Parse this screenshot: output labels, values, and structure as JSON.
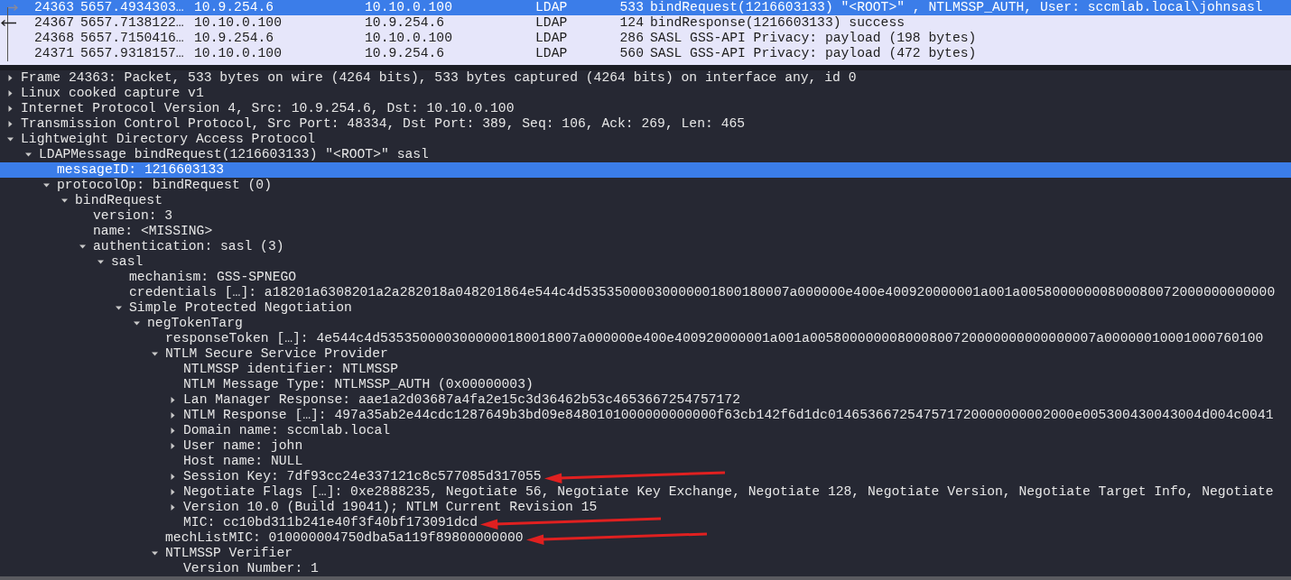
{
  "packet_list": {
    "rows": [
      {
        "no": "24363",
        "time": "5657.4934303…",
        "source": "10.9.254.6",
        "destination": "10.10.0.100",
        "protocol": "LDAP",
        "length": "533",
        "info": "bindRequest(1216603133) \"<ROOT>\" , NTLMSSP_AUTH, User: sccmlab.local\\johnsasl",
        "selected": true,
        "kind": "request"
      },
      {
        "no": "24367",
        "time": "5657.7138122…",
        "source": "10.10.0.100",
        "destination": "10.9.254.6",
        "protocol": "LDAP",
        "length": "124",
        "info": "bindResponse(1216603133) success",
        "selected": false,
        "kind": "response"
      },
      {
        "no": "24368",
        "time": "5657.7150416…",
        "source": "10.9.254.6",
        "destination": "10.10.0.100",
        "protocol": "LDAP",
        "length": "286",
        "info": "SASL GSS-API Privacy: payload (198 bytes)",
        "selected": false,
        "kind": "related"
      },
      {
        "no": "24371",
        "time": "5657.9318157…",
        "source": "10.10.0.100",
        "destination": "10.9.254.6",
        "protocol": "LDAP",
        "length": "560",
        "info": "SASL GSS-API Privacy: payload (472 bytes)",
        "selected": false,
        "kind": "related"
      }
    ]
  },
  "details": {
    "tree": [
      {
        "label": "Frame 24363: Packet, 533 bytes on wire (4264 bits), 533 bytes captured (4264 bits) on interface any, id 0",
        "expanded": false,
        "selected": false
      },
      {
        "label": "Linux cooked capture v1",
        "expanded": false,
        "selected": false
      },
      {
        "label": "Internet Protocol Version 4, Src: 10.9.254.6, Dst: 10.10.0.100",
        "expanded": false,
        "selected": false
      },
      {
        "label": "Transmission Control Protocol, Src Port: 48334, Dst Port: 389, Seq: 106, Ack: 269, Len: 465",
        "expanded": false,
        "selected": false
      },
      {
        "label": "Lightweight Directory Access Protocol",
        "expanded": true,
        "selected": false,
        "children": [
          {
            "label": "LDAPMessage bindRequest(1216603133) \"<ROOT>\" sasl",
            "expanded": true,
            "selected": false,
            "children": [
              {
                "label": "messageID: 1216603133",
                "selected": true
              },
              {
                "label": "protocolOp: bindRequest (0)",
                "expanded": true,
                "selected": false,
                "children": [
                  {
                    "label": "bindRequest",
                    "expanded": true,
                    "selected": false,
                    "children": [
                      {
                        "label": "version: 3",
                        "selected": false
                      },
                      {
                        "label": "name: <MISSING>",
                        "selected": false
                      },
                      {
                        "label": "authentication: sasl (3)",
                        "expanded": true,
                        "selected": false,
                        "children": [
                          {
                            "label": "sasl",
                            "expanded": true,
                            "selected": false,
                            "children": [
                              {
                                "label": "mechanism: GSS-SPNEGO",
                                "selected": false
                              },
                              {
                                "label": "credentials […]: a18201a6308201a2a282018a048201864e544c4d53535000030000001800180007a000000e400e400920000001a001a00580000000800080072000000000000",
                                "selected": false
                              },
                              {
                                "label": "Simple Protected Negotiation",
                                "expanded": true,
                                "selected": false,
                                "children": [
                                  {
                                    "label": "negTokenTarg",
                                    "expanded": true,
                                    "selected": false,
                                    "children": [
                                      {
                                        "label": "responseToken […]: 4e544c4d5353500003000000180018007a000000e400e400920000001a001a005800000008000800720000000000000007a00000010001000760100",
                                        "selected": false
                                      },
                                      {
                                        "label": "NTLM Secure Service Provider",
                                        "expanded": true,
                                        "selected": false,
                                        "children": [
                                          {
                                            "label": "NTLMSSP identifier: NTLMSSP",
                                            "selected": false
                                          },
                                          {
                                            "label": "NTLM Message Type: NTLMSSP_AUTH (0x00000003)",
                                            "selected": false
                                          },
                                          {
                                            "label": "Lan Manager Response: aae1a2d03687a4fa2e15c3d36462b53c4653667254757172",
                                            "expanded": false,
                                            "selected": false
                                          },
                                          {
                                            "label": "NTLM Response […]: 497a35ab2e44cdc1287649b3bd09e8480101000000000000f63cb142f6d1dc0146536672547571720000000002000e005300430043004d004c0041",
                                            "expanded": false,
                                            "selected": false
                                          },
                                          {
                                            "label": "Domain name: sccmlab.local",
                                            "expanded": false,
                                            "selected": false
                                          },
                                          {
                                            "label": "User name: john",
                                            "expanded": false,
                                            "selected": false
                                          },
                                          {
                                            "label": "Host name: NULL",
                                            "selected": false
                                          },
                                          {
                                            "label": "Session Key: 7df93cc24e337121c8c577085d317055",
                                            "expanded": false,
                                            "selected": false,
                                            "marked": true
                                          },
                                          {
                                            "label": "Negotiate Flags […]: 0xe2888235, Negotiate 56, Negotiate Key Exchange, Negotiate 128, Negotiate Version, Negotiate Target Info, Negotiate",
                                            "expanded": false,
                                            "selected": false
                                          },
                                          {
                                            "label": "Version 10.0 (Build 19041); NTLM Current Revision 15",
                                            "expanded": false,
                                            "selected": false
                                          },
                                          {
                                            "label": "MIC: cc10bd311b241e40f3f40bf173091dcd",
                                            "selected": false,
                                            "marked": true
                                          }
                                        ]
                                      },
                                      {
                                        "label": "mechListMIC: 010000004750dba5a119f89800000000",
                                        "selected": false,
                                        "marked": true
                                      },
                                      {
                                        "label": "NTLMSSP Verifier",
                                        "expanded": true,
                                        "selected": false,
                                        "children": [
                                          {
                                            "label": "Version Number: 1",
                                            "selected": false
                                          }
                                        ]
                                      }
                                    ]
                                  }
                                ]
                              }
                            ]
                          }
                        ]
                      }
                    ]
                  }
                ]
              }
            ]
          }
        ]
      }
    ]
  }
}
